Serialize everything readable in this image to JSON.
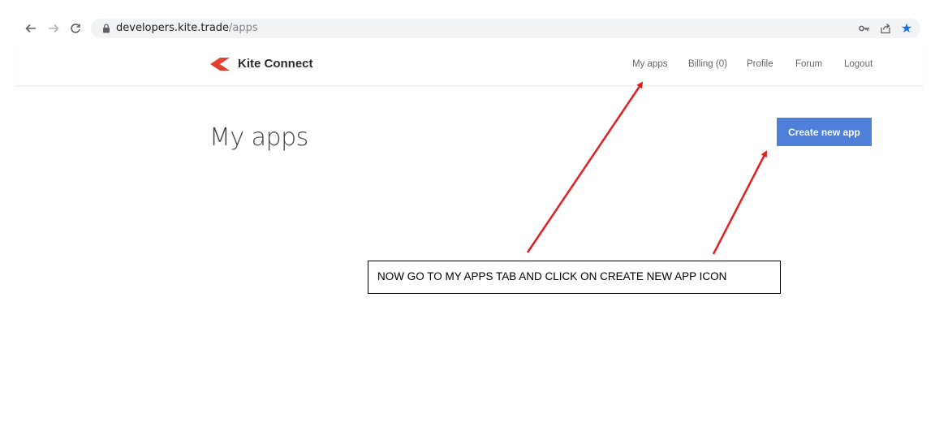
{
  "browser": {
    "url_host": "developers.kite.trade",
    "url_path": "/apps",
    "icons": [
      "back-icon",
      "forward-icon",
      "reload-icon",
      "lock-icon",
      "key-icon",
      "share-icon",
      "bookmark-star-icon"
    ]
  },
  "header": {
    "brand": "Kite Connect",
    "nav": {
      "my_apps": "My apps",
      "billing": "Billing (0)",
      "profile": "Profile",
      "forum": "Forum",
      "logout": "Logout"
    }
  },
  "main": {
    "title": "My apps",
    "create_button": "Create new app"
  },
  "annotation": {
    "text": "NOW GO TO MY APPS TAB AND CLICK ON CREATE NEW APP ICON"
  },
  "colors": {
    "accent_button": "#4e7fd9",
    "logo": "#e0432f",
    "arrow": "#e21f1f",
    "star": "#1a73e8"
  }
}
